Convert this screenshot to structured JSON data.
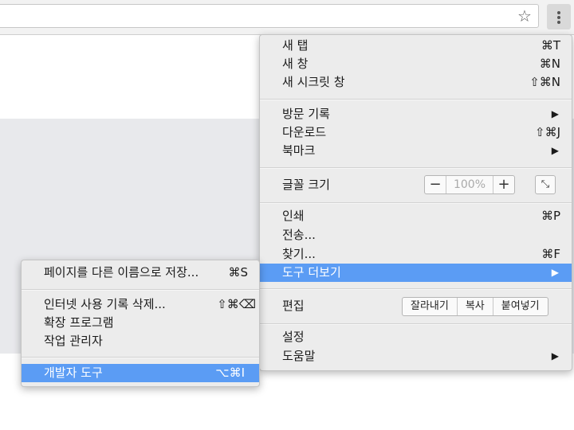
{
  "toolbar": {
    "star_icon": "☆",
    "menu_icon": "three-dot-vertical"
  },
  "main_menu": {
    "new_tab": {
      "label": "새 탭",
      "shortcut": "⌘T"
    },
    "new_window": {
      "label": "새 창",
      "shortcut": "⌘N"
    },
    "new_incognito": {
      "label": "새 시크릿 창",
      "shortcut": "⇧⌘N"
    },
    "history": {
      "label": "방문 기록",
      "arrow": "▶"
    },
    "downloads": {
      "label": "다운로드",
      "shortcut": "⇧⌘J"
    },
    "bookmarks": {
      "label": "북마크",
      "arrow": "▶"
    },
    "zoom": {
      "label": "글꼴 크기",
      "minus": "−",
      "value": "100%",
      "plus": "+",
      "fullscreen_icon": "⤡"
    },
    "print": {
      "label": "인쇄",
      "shortcut": "⌘P"
    },
    "cast": {
      "label": "전송..."
    },
    "find": {
      "label": "찾기...",
      "shortcut": "⌘F"
    },
    "more_tools": {
      "label": "도구 더보기",
      "arrow": "▶"
    },
    "edit": {
      "label": "편집",
      "cut": "잘라내기",
      "copy": "복사",
      "paste": "붙여넣기"
    },
    "settings": {
      "label": "설정"
    },
    "help": {
      "label": "도움말",
      "arrow": "▶"
    }
  },
  "sub_menu": {
    "save_as": {
      "label": "페이지를 다른 이름으로 저장...",
      "shortcut": "⌘S"
    },
    "clear_data": {
      "label": "인터넷 사용 기록 삭제...",
      "shortcut": "⇧⌘⌫"
    },
    "extensions": {
      "label": "확장 프로그램"
    },
    "task_manager": {
      "label": "작업 관리자"
    },
    "developer_tools": {
      "label": "개발자 도구",
      "shortcut": "⌥⌘I"
    }
  },
  "colors": {
    "highlight": "#5b9cf4",
    "menu_bg": "#ececec",
    "page_gray": "#e8e9ec"
  }
}
